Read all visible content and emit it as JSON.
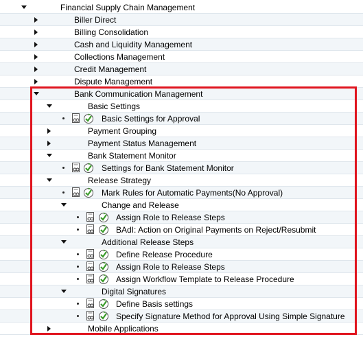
{
  "tree": {
    "root": "Financial Supply Chain Management",
    "items": [
      {
        "label": "Biller Direct"
      },
      {
        "label": "Billing Consolidation"
      },
      {
        "label": "Cash and Liquidity Management"
      },
      {
        "label": "Collections Management"
      },
      {
        "label": "Credit Management"
      },
      {
        "label": "Dispute Management"
      },
      {
        "label": "Bank Communication Management"
      },
      {
        "label": "Basic Settings"
      },
      {
        "label": "Basic Settings for Approval"
      },
      {
        "label": "Payment Grouping"
      },
      {
        "label": "Payment Status Management"
      },
      {
        "label": "Bank Statement Monitor"
      },
      {
        "label": "Settings for Bank Statement Monitor"
      },
      {
        "label": "Release Strategy"
      },
      {
        "label": "Mark Rules for Automatic Payments(No Approval)"
      },
      {
        "label": "Change and Release"
      },
      {
        "label": "Assign Role to Release Steps"
      },
      {
        "label": "BAdI: Action on Original Payments on Reject/Resubmit"
      },
      {
        "label": "Additional Release Steps"
      },
      {
        "label": "Define Release Procedure"
      },
      {
        "label": "Assign Role to Release Steps"
      },
      {
        "label": "Assign Workflow Template to Release Procedure"
      },
      {
        "label": "Digital Signatures"
      },
      {
        "label": "Define Basis settings"
      },
      {
        "label": "Specify Signature Method for Approval Using Simple Signature"
      },
      {
        "label": "Mobile Applications"
      }
    ]
  },
  "colors": {
    "highlight_border": "#e0141e",
    "row_alt": "#f2f6f9",
    "exec_icon_green": "#3a9a2a"
  },
  "icons": {
    "expanded": "triangle-down-icon",
    "collapsed": "triangle-right-icon",
    "document": "documentation-icon",
    "execute": "execute-clock-icon"
  }
}
